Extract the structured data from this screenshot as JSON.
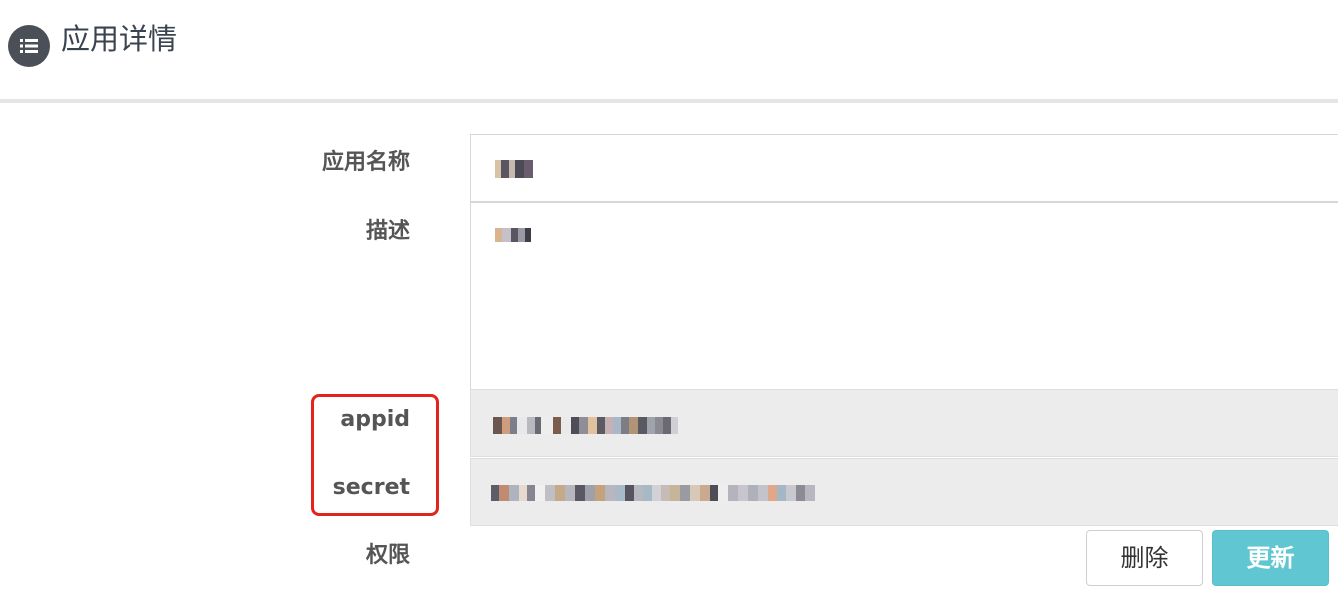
{
  "header": {
    "title": "应用详情",
    "icon": "list-icon"
  },
  "form": {
    "name_label": "应用名称",
    "name_value": "test",
    "desc_label": "描述",
    "desc_value": "test",
    "appid_label": "appid",
    "appid_value": "[redacted]",
    "secret_label": "secret",
    "secret_value": "[redacted]",
    "permission_label": "权限"
  },
  "actions": {
    "delete_label": "删除",
    "update_label": "更新"
  },
  "annotation": {
    "highlight_color": "#e1251b"
  }
}
